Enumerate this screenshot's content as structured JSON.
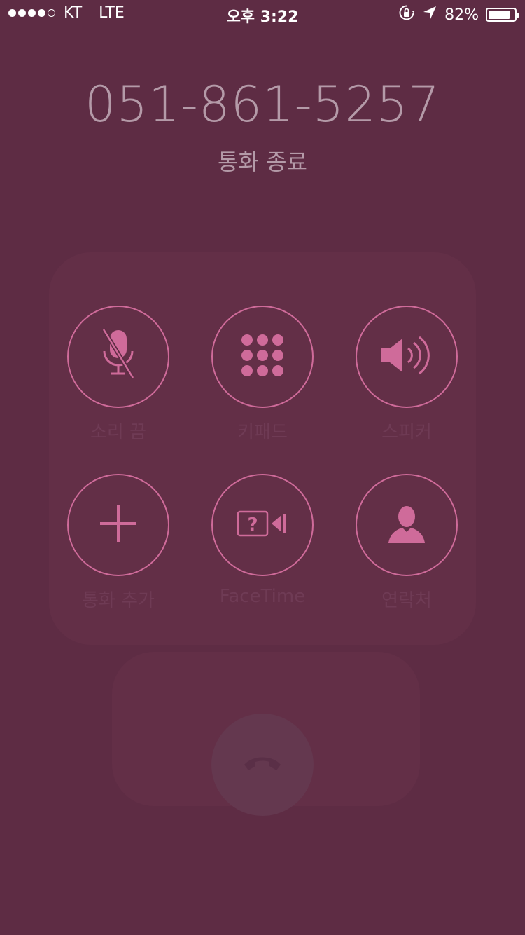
{
  "status_bar": {
    "carrier": "KT",
    "network": "LTE",
    "time": "오후 3:22",
    "battery": "82%",
    "battery_level": 0.82,
    "signal_bars_filled": 4,
    "signal_bars_total": 5,
    "icons": [
      "orientation-lock-icon",
      "location-arrow-icon",
      "battery-icon"
    ]
  },
  "call": {
    "number": "051-861-5257",
    "status": "통화 종료"
  },
  "controls": [
    {
      "id": "mute",
      "label": "소리 끔",
      "icon": "mic-muted-icon"
    },
    {
      "id": "keypad",
      "label": "키패드",
      "icon": "keypad-icon"
    },
    {
      "id": "speaker",
      "label": "스피커",
      "icon": "speaker-icon"
    },
    {
      "id": "add_call",
      "label": "통화 추가",
      "icon": "plus-icon"
    },
    {
      "id": "facetime",
      "label": "FaceTime",
      "icon": "facetime-icon"
    },
    {
      "id": "contacts",
      "label": "연락처",
      "icon": "contact-icon"
    }
  ],
  "end_call": {
    "icon": "phone-hangup-icon"
  },
  "colors": {
    "background": "#5e2c44",
    "accent": "#cf6b9a",
    "text_dim": "#b49aa8",
    "label_dim": "#6f3b55",
    "end_button": "#64384f"
  }
}
